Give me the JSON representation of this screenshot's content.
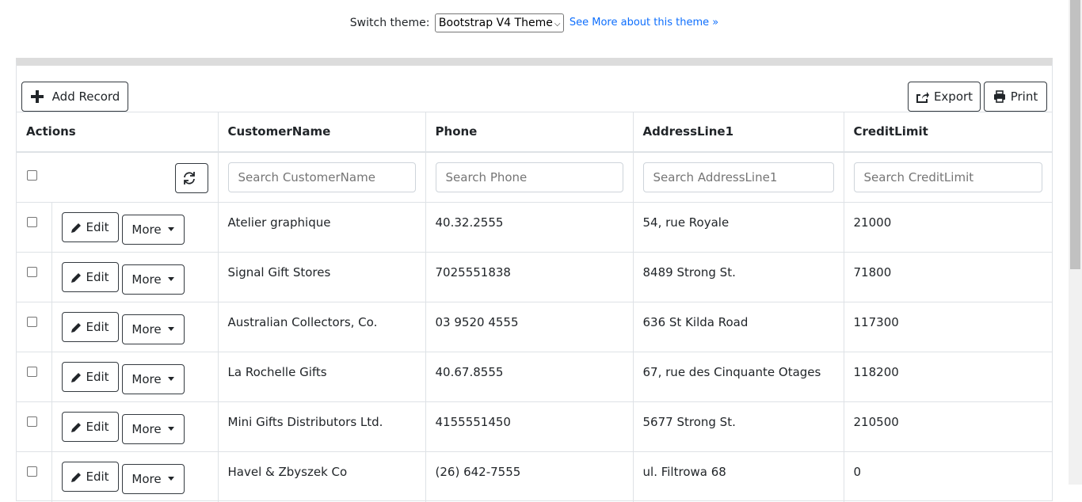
{
  "theme_bar": {
    "label": "Switch theme:",
    "selected": "Bootstrap V4 Theme",
    "link": "See More about this theme »"
  },
  "toolbar": {
    "add_label": "Add Record",
    "export_label": "Export",
    "print_label": "Print"
  },
  "columns": {
    "actions": "Actions",
    "customer": "CustomerName",
    "phone": "Phone",
    "address": "AddressLine1",
    "credit": "CreditLimit"
  },
  "filters": {
    "customer": "Search CustomerName",
    "phone": "Search Phone",
    "address": "Search AddressLine1",
    "credit": "Search CreditLimit"
  },
  "row_buttons": {
    "edit": "Edit",
    "more": "More"
  },
  "rows": [
    {
      "customer": "Atelier graphique",
      "phone": "40.32.2555",
      "address": "54, rue Royale",
      "credit": "21000"
    },
    {
      "customer": "Signal Gift Stores",
      "phone": "7025551838",
      "address": "8489 Strong St.",
      "credit": "71800"
    },
    {
      "customer": "Australian Collectors, Co.",
      "phone": "03 9520 4555",
      "address": "636 St Kilda Road",
      "credit": "117300"
    },
    {
      "customer": "La Rochelle Gifts",
      "phone": "40.67.8555",
      "address": "67, rue des Cinquante Otages",
      "credit": "118200"
    },
    {
      "customer": "Mini Gifts Distributors Ltd.",
      "phone": "4155551450",
      "address": "5677 Strong St.",
      "credit": "210500"
    },
    {
      "customer": "Havel & Zbyszek Co",
      "phone": "(26) 642-7555",
      "address": "ul. Filtrowa 68",
      "credit": "0"
    }
  ]
}
